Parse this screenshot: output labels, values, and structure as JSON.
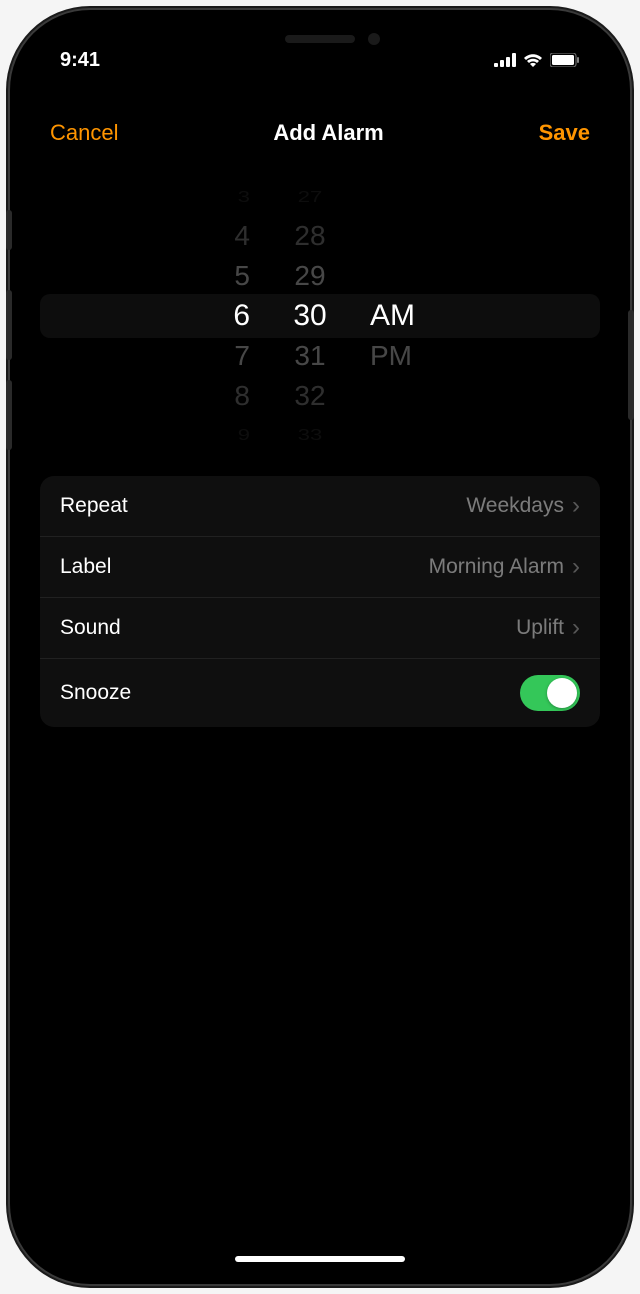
{
  "status": {
    "time": "9:41"
  },
  "nav": {
    "cancel": "Cancel",
    "title": "Add Alarm",
    "save": "Save"
  },
  "picker": {
    "hour_minus3": "3",
    "hour_minus2": "4",
    "hour_minus1": "5",
    "hour_selected": "6",
    "hour_plus1": "7",
    "hour_plus2": "8",
    "hour_plus3": "9",
    "minute_minus3": "27",
    "minute_minus2": "28",
    "minute_minus1": "29",
    "minute_selected": "30",
    "minute_plus1": "31",
    "minute_plus2": "32",
    "minute_plus3": "33",
    "period_selected": "AM",
    "period_other": "PM"
  },
  "settings": {
    "repeat_label": "Repeat",
    "repeat_value": "Weekdays",
    "label_label": "Label",
    "label_value": "Morning Alarm",
    "sound_label": "Sound",
    "sound_value": "Uplift",
    "snooze_label": "Snooze",
    "snooze_on": true
  }
}
